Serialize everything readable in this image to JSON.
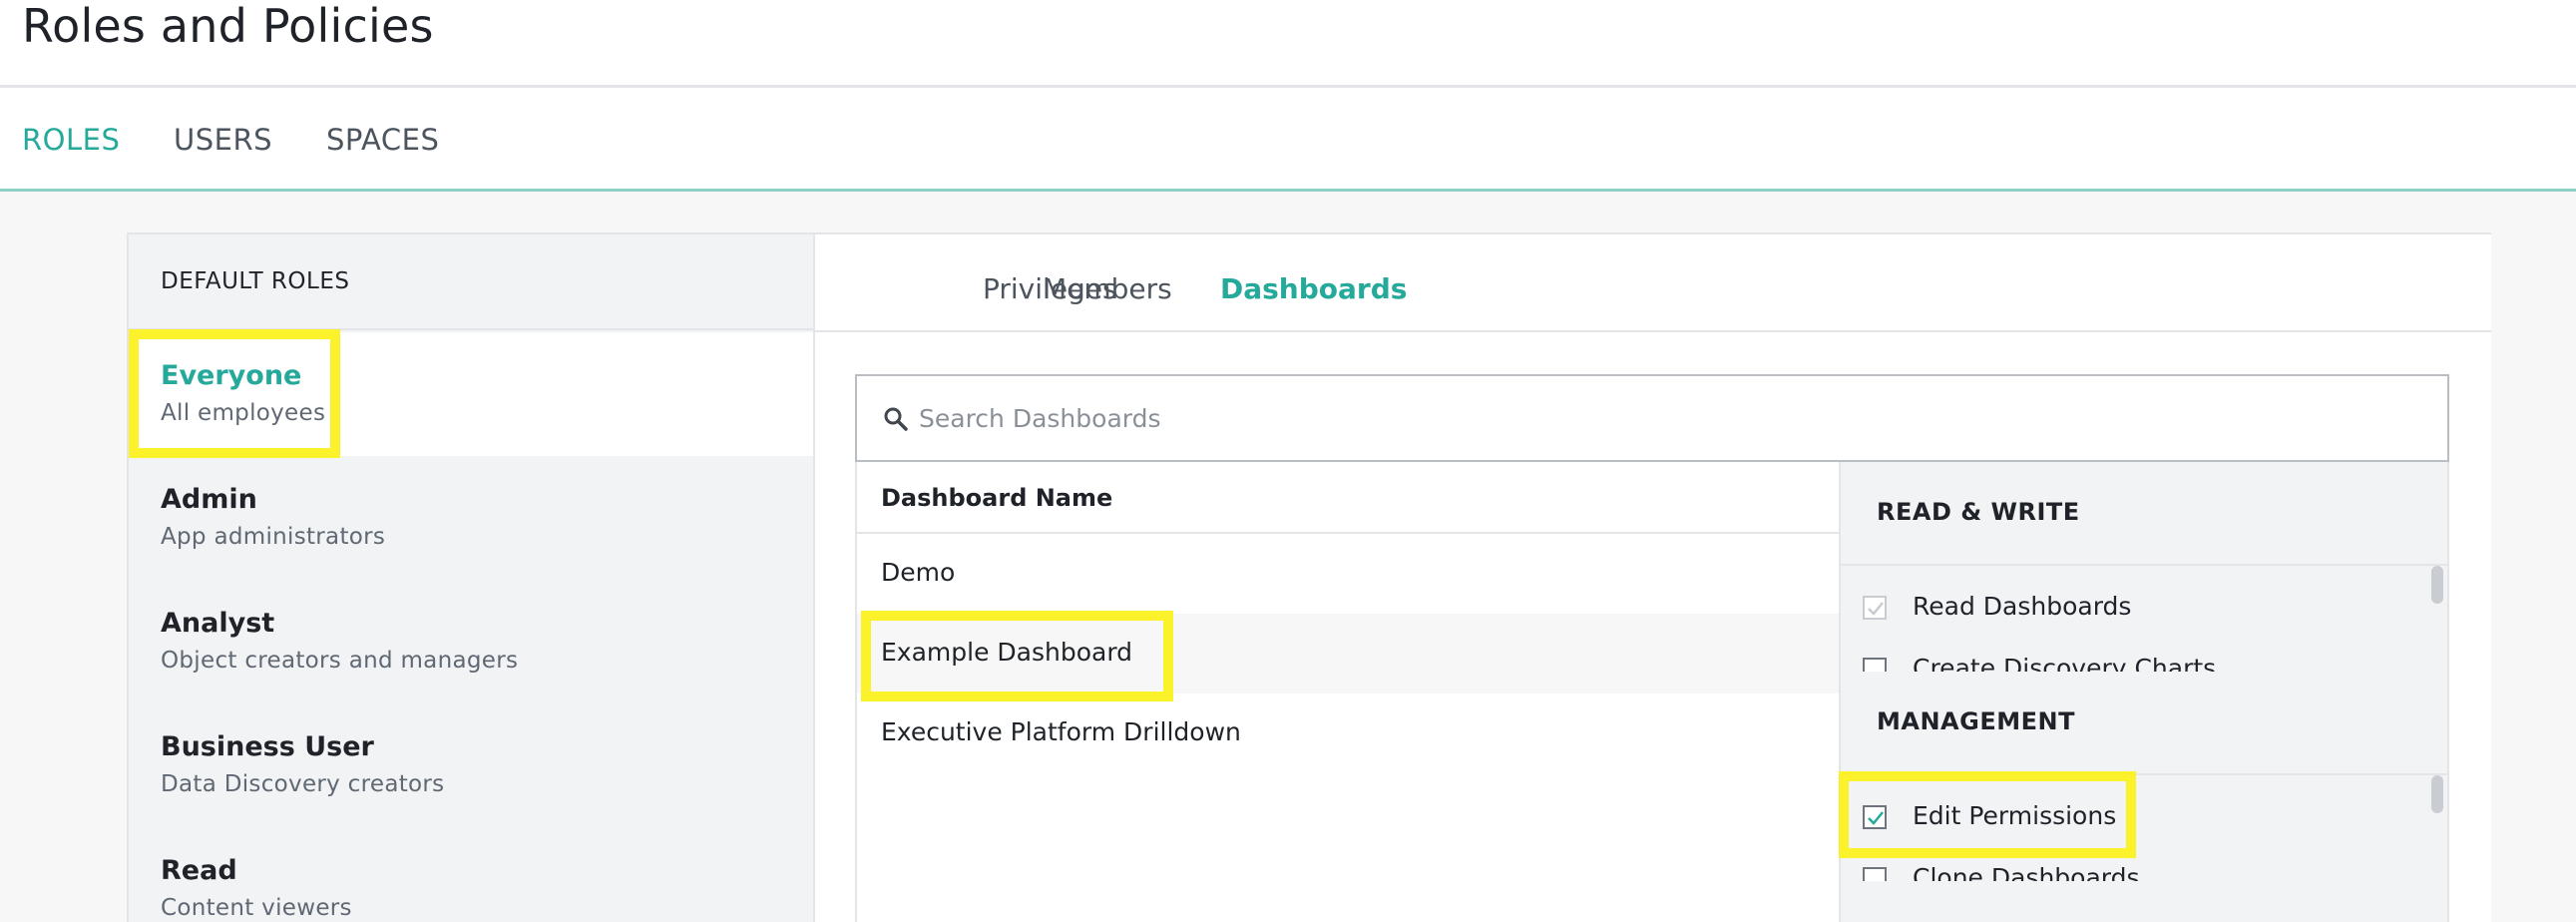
{
  "page": {
    "title": "Roles and Policies"
  },
  "top_nav": {
    "tabs": [
      {
        "label": "ROLES",
        "active": true
      },
      {
        "label": "USERS",
        "active": false
      },
      {
        "label": "SPACES",
        "active": false
      }
    ]
  },
  "roles": {
    "header": "DEFAULT ROLES",
    "items": [
      {
        "name": "Everyone",
        "description": "All employees",
        "selected": true
      },
      {
        "name": "Admin",
        "description": "App administrators",
        "selected": false
      },
      {
        "name": "Analyst",
        "description": "Object creators and managers",
        "selected": false
      },
      {
        "name": "Business User",
        "description": "Data Discovery creators",
        "selected": false
      },
      {
        "name": "Read",
        "description": "Content viewers",
        "selected": false
      }
    ]
  },
  "content": {
    "tabs": [
      {
        "label": "Privileges",
        "active": false
      },
      {
        "label": "Members",
        "active": false
      },
      {
        "label": "Dashboards",
        "active": true
      }
    ],
    "search": {
      "placeholder": "Search Dashboards",
      "value": "",
      "icon": "search-icon"
    },
    "dashboards": {
      "column_header": "Dashboard Name",
      "rows": [
        {
          "name": "Demo"
        },
        {
          "name": "Example Dashboard",
          "selected": true
        },
        {
          "name": "Executive Platform Drilldown"
        }
      ]
    },
    "permissions": {
      "read_write": {
        "title": "READ & WRITE",
        "items": [
          {
            "label": "Read Dashboards",
            "checked": true,
            "disabled": true
          },
          {
            "label": "Create Discovery Charts",
            "checked": false,
            "disabled": false
          }
        ]
      },
      "management": {
        "title": "MANAGEMENT",
        "items": [
          {
            "label": "Edit Permissions",
            "checked": true,
            "disabled": false
          },
          {
            "label": "Clone Dashboards",
            "checked": false,
            "disabled": false
          }
        ]
      }
    }
  },
  "colors": {
    "accent": "#25a99a",
    "highlight": "#fbf22b",
    "text": "#1f2329",
    "muted": "#5f6873"
  }
}
